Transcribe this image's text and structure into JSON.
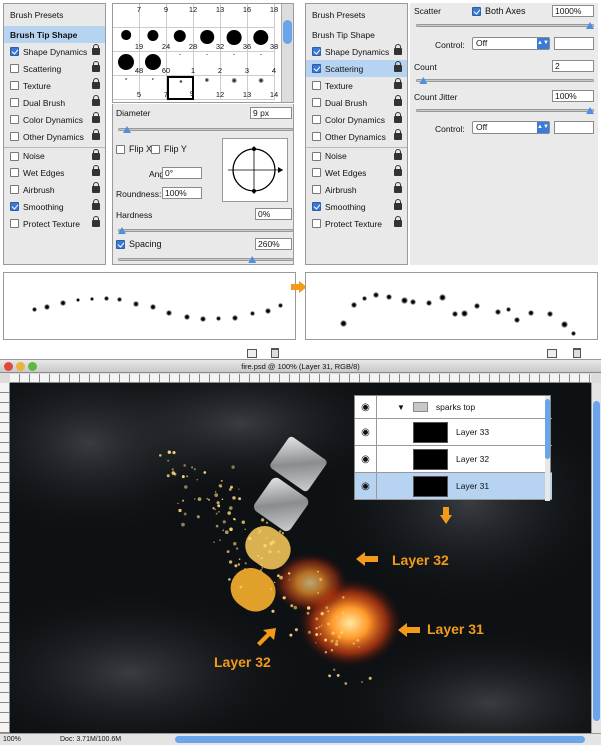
{
  "left_panel": {
    "header": "Brush Presets",
    "items": [
      {
        "label": "Brush Tip Shape",
        "checkbox": false,
        "lock": false,
        "selected": true,
        "bold": true
      },
      {
        "label": "Shape Dynamics",
        "checkbox": true,
        "lock": true
      },
      {
        "label": "Scattering",
        "checkbox": false,
        "lock": true
      },
      {
        "label": "Texture",
        "checkbox": false,
        "lock": true
      },
      {
        "label": "Dual Brush",
        "checkbox": false,
        "lock": true
      },
      {
        "label": "Color Dynamics",
        "checkbox": false,
        "lock": true
      },
      {
        "label": "Other Dynamics",
        "checkbox": false,
        "lock": true
      },
      {
        "label": "Noise",
        "checkbox": false,
        "lock": true
      },
      {
        "label": "Wet Edges",
        "checkbox": false,
        "lock": true
      },
      {
        "label": "Airbrush",
        "checkbox": false,
        "lock": true
      },
      {
        "label": "Smoothing",
        "checkbox": true,
        "lock": true
      },
      {
        "label": "Protect Texture",
        "checkbox": false,
        "lock": true
      }
    ]
  },
  "brush_grid": {
    "cells": [
      "7",
      "9",
      "12",
      "13",
      "16",
      "18",
      "19",
      "24",
      "28",
      "32",
      "36",
      "38",
      "48",
      "60",
      "1",
      "2",
      "3",
      "4",
      "5",
      "7",
      "9",
      "12",
      "13",
      "14"
    ],
    "selected_index": 20
  },
  "tip_shape": {
    "diameter_label": "Diameter",
    "diameter_value": "9 px",
    "diameter_level": 0.03,
    "flip_x": "Flip X",
    "flip_y": "Flip Y",
    "angle_label": "Angle:",
    "angle_value": "0°",
    "roundness_label": "Roundness:",
    "roundness_value": "100%",
    "hardness_label": "Hardness",
    "hardness_value": "0%",
    "hardness_level": 0.0,
    "spacing_label": "Spacing",
    "spacing_checked": true,
    "spacing_value": "260%",
    "spacing_level": 0.78
  },
  "right_panel": {
    "header": "Brush Presets",
    "items": [
      {
        "label": "Brush Tip Shape",
        "checkbox": false,
        "lock": false,
        "selected": false
      },
      {
        "label": "Shape Dynamics",
        "checkbox": true,
        "lock": true
      },
      {
        "label": "Scattering",
        "checkbox": true,
        "lock": true,
        "selected": true
      },
      {
        "label": "Texture",
        "checkbox": false,
        "lock": true
      },
      {
        "label": "Dual Brush",
        "checkbox": false,
        "lock": true
      },
      {
        "label": "Color Dynamics",
        "checkbox": false,
        "lock": true
      },
      {
        "label": "Other Dynamics",
        "checkbox": false,
        "lock": true
      },
      {
        "label": "Noise",
        "checkbox": false,
        "lock": true
      },
      {
        "label": "Wet Edges",
        "checkbox": false,
        "lock": true
      },
      {
        "label": "Airbrush",
        "checkbox": false,
        "lock": true
      },
      {
        "label": "Smoothing",
        "checkbox": true,
        "lock": true
      },
      {
        "label": "Protect Texture",
        "checkbox": false,
        "lock": true
      }
    ]
  },
  "scatter": {
    "scatter_label": "Scatter",
    "both_axes": "Both Axes",
    "scatter_value": "1000%",
    "scatter_level": 1.0,
    "control_label": "Control:",
    "control_value": "Off",
    "count_label": "Count",
    "count_value": "2",
    "count_level": 0.02,
    "count_jitter_label": "Count Jitter",
    "count_jitter_value": "100%",
    "count_jitter_level": 1.0,
    "control2_label": "Control:",
    "control2_value": "Off"
  },
  "doc_window": {
    "title": "fire.psd @ 100% (Layer 31, RGB/8)",
    "zoom": "100%",
    "doc_info": "Doc: 3.71M/100.6M"
  },
  "layers": {
    "group_name": "sparks top",
    "rows": [
      {
        "name": "Layer 33",
        "selected": false
      },
      {
        "name": "Layer 32",
        "selected": false
      },
      {
        "name": "Layer 31",
        "selected": true
      }
    ]
  },
  "callouts": {
    "a": "Layer 32",
    "b": "Layer 31",
    "c": "Layer 32"
  },
  "colors": {
    "accent": "#f39a1b",
    "selection": "#b7d3f2",
    "canvas_bg": "#0e1114"
  }
}
